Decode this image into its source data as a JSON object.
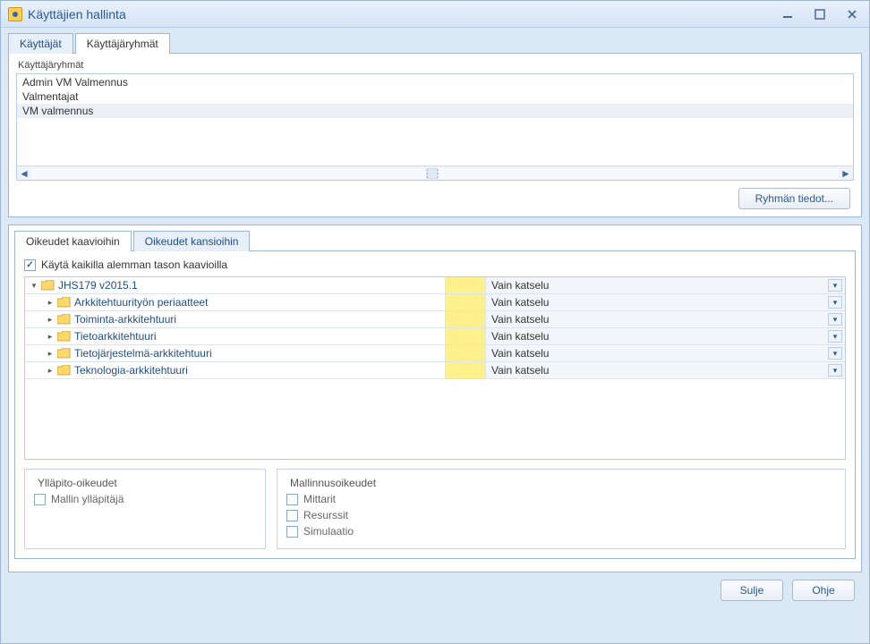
{
  "window": {
    "title": "Käyttäjien hallinta"
  },
  "topTabs": [
    {
      "label": "Käyttäjät",
      "active": false
    },
    {
      "label": "Käyttäjäryhmät",
      "active": true
    }
  ],
  "groupsLabel": "Käyttäjäryhmät",
  "groups": [
    {
      "name": "Admin VM Valmennus",
      "selected": false
    },
    {
      "name": "Valmentajat",
      "selected": false
    },
    {
      "name": "VM valmennus",
      "selected": true
    }
  ],
  "groupDetailsBtn": "Ryhmän tiedot...",
  "innerTabs": [
    {
      "label": "Oikeudet kaavioihin",
      "active": true
    },
    {
      "label": "Oikeudet kansioihin",
      "active": false
    }
  ],
  "applyAllLabel": "Käytä kaikilla alemman tason kaavioilla",
  "applyAllChecked": true,
  "tree": [
    {
      "indent": 0,
      "expander": "down",
      "label": "JHS179 v2015.1",
      "selected": true,
      "color": "#fef08a",
      "perm": "Vain katselu"
    },
    {
      "indent": 1,
      "expander": "right",
      "label": "Arkkitehtuurityön periaatteet",
      "color": "#fef08a",
      "perm": "Vain katselu"
    },
    {
      "indent": 1,
      "expander": "right",
      "label": "Toiminta-arkkitehtuuri",
      "color": "#fef08a",
      "perm": "Vain katselu"
    },
    {
      "indent": 1,
      "expander": "right",
      "label": "Tietoarkkitehtuuri",
      "color": "#fef08a",
      "perm": "Vain katselu"
    },
    {
      "indent": 1,
      "expander": "right",
      "label": "Tietojärjestelmä-arkkitehtuuri",
      "color": "#fef08a",
      "perm": "Vain katselu"
    },
    {
      "indent": 1,
      "expander": "right",
      "label": "Teknologia-arkkitehtuuri",
      "color": "#fef08a",
      "perm": "Vain katselu"
    }
  ],
  "adminBox": {
    "title": "Ylläpito-oikeudet",
    "opts": [
      {
        "label": "Mallin ylläpitäjä",
        "checked": false
      }
    ]
  },
  "modelBox": {
    "title": "Mallinnusoikeudet",
    "opts": [
      {
        "label": "Mittarit",
        "checked": false
      },
      {
        "label": "Resurssit",
        "checked": false
      },
      {
        "label": "Simulaatio",
        "checked": false
      }
    ]
  },
  "closeBtn": "Sulje",
  "helpBtn": "Ohje"
}
